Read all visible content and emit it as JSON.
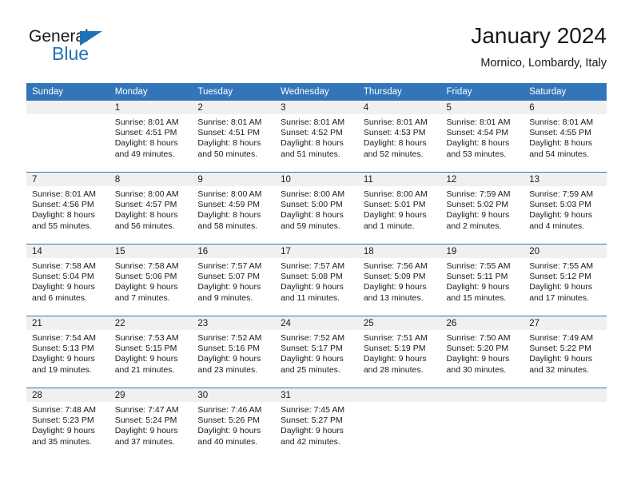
{
  "brand": {
    "name_top": "General",
    "name_bottom": "Blue",
    "accent_color": "#1e72b8"
  },
  "header": {
    "title": "January 2024",
    "subtitle": "Mornico, Lombardy, Italy"
  },
  "calendar": {
    "header_bg": "#3275b9",
    "daynum_bg": "#f0f0f0",
    "weekday_headers": [
      "Sunday",
      "Monday",
      "Tuesday",
      "Wednesday",
      "Thursday",
      "Friday",
      "Saturday"
    ],
    "weeks": [
      [
        {
          "day": ""
        },
        {
          "day": "1",
          "sunrise": "Sunrise: 8:01 AM",
          "sunset": "Sunset: 4:51 PM",
          "daylight_1": "Daylight: 8 hours",
          "daylight_2": "and 49 minutes."
        },
        {
          "day": "2",
          "sunrise": "Sunrise: 8:01 AM",
          "sunset": "Sunset: 4:51 PM",
          "daylight_1": "Daylight: 8 hours",
          "daylight_2": "and 50 minutes."
        },
        {
          "day": "3",
          "sunrise": "Sunrise: 8:01 AM",
          "sunset": "Sunset: 4:52 PM",
          "daylight_1": "Daylight: 8 hours",
          "daylight_2": "and 51 minutes."
        },
        {
          "day": "4",
          "sunrise": "Sunrise: 8:01 AM",
          "sunset": "Sunset: 4:53 PM",
          "daylight_1": "Daylight: 8 hours",
          "daylight_2": "and 52 minutes."
        },
        {
          "day": "5",
          "sunrise": "Sunrise: 8:01 AM",
          "sunset": "Sunset: 4:54 PM",
          "daylight_1": "Daylight: 8 hours",
          "daylight_2": "and 53 minutes."
        },
        {
          "day": "6",
          "sunrise": "Sunrise: 8:01 AM",
          "sunset": "Sunset: 4:55 PM",
          "daylight_1": "Daylight: 8 hours",
          "daylight_2": "and 54 minutes."
        }
      ],
      [
        {
          "day": "7",
          "sunrise": "Sunrise: 8:01 AM",
          "sunset": "Sunset: 4:56 PM",
          "daylight_1": "Daylight: 8 hours",
          "daylight_2": "and 55 minutes."
        },
        {
          "day": "8",
          "sunrise": "Sunrise: 8:00 AM",
          "sunset": "Sunset: 4:57 PM",
          "daylight_1": "Daylight: 8 hours",
          "daylight_2": "and 56 minutes."
        },
        {
          "day": "9",
          "sunrise": "Sunrise: 8:00 AM",
          "sunset": "Sunset: 4:59 PM",
          "daylight_1": "Daylight: 8 hours",
          "daylight_2": "and 58 minutes."
        },
        {
          "day": "10",
          "sunrise": "Sunrise: 8:00 AM",
          "sunset": "Sunset: 5:00 PM",
          "daylight_1": "Daylight: 8 hours",
          "daylight_2": "and 59 minutes."
        },
        {
          "day": "11",
          "sunrise": "Sunrise: 8:00 AM",
          "sunset": "Sunset: 5:01 PM",
          "daylight_1": "Daylight: 9 hours",
          "daylight_2": "and 1 minute."
        },
        {
          "day": "12",
          "sunrise": "Sunrise: 7:59 AM",
          "sunset": "Sunset: 5:02 PM",
          "daylight_1": "Daylight: 9 hours",
          "daylight_2": "and 2 minutes."
        },
        {
          "day": "13",
          "sunrise": "Sunrise: 7:59 AM",
          "sunset": "Sunset: 5:03 PM",
          "daylight_1": "Daylight: 9 hours",
          "daylight_2": "and 4 minutes."
        }
      ],
      [
        {
          "day": "14",
          "sunrise": "Sunrise: 7:58 AM",
          "sunset": "Sunset: 5:04 PM",
          "daylight_1": "Daylight: 9 hours",
          "daylight_2": "and 6 minutes."
        },
        {
          "day": "15",
          "sunrise": "Sunrise: 7:58 AM",
          "sunset": "Sunset: 5:06 PM",
          "daylight_1": "Daylight: 9 hours",
          "daylight_2": "and 7 minutes."
        },
        {
          "day": "16",
          "sunrise": "Sunrise: 7:57 AM",
          "sunset": "Sunset: 5:07 PM",
          "daylight_1": "Daylight: 9 hours",
          "daylight_2": "and 9 minutes."
        },
        {
          "day": "17",
          "sunrise": "Sunrise: 7:57 AM",
          "sunset": "Sunset: 5:08 PM",
          "daylight_1": "Daylight: 9 hours",
          "daylight_2": "and 11 minutes."
        },
        {
          "day": "18",
          "sunrise": "Sunrise: 7:56 AM",
          "sunset": "Sunset: 5:09 PM",
          "daylight_1": "Daylight: 9 hours",
          "daylight_2": "and 13 minutes."
        },
        {
          "day": "19",
          "sunrise": "Sunrise: 7:55 AM",
          "sunset": "Sunset: 5:11 PM",
          "daylight_1": "Daylight: 9 hours",
          "daylight_2": "and 15 minutes."
        },
        {
          "day": "20",
          "sunrise": "Sunrise: 7:55 AM",
          "sunset": "Sunset: 5:12 PM",
          "daylight_1": "Daylight: 9 hours",
          "daylight_2": "and 17 minutes."
        }
      ],
      [
        {
          "day": "21",
          "sunrise": "Sunrise: 7:54 AM",
          "sunset": "Sunset: 5:13 PM",
          "daylight_1": "Daylight: 9 hours",
          "daylight_2": "and 19 minutes."
        },
        {
          "day": "22",
          "sunrise": "Sunrise: 7:53 AM",
          "sunset": "Sunset: 5:15 PM",
          "daylight_1": "Daylight: 9 hours",
          "daylight_2": "and 21 minutes."
        },
        {
          "day": "23",
          "sunrise": "Sunrise: 7:52 AM",
          "sunset": "Sunset: 5:16 PM",
          "daylight_1": "Daylight: 9 hours",
          "daylight_2": "and 23 minutes."
        },
        {
          "day": "24",
          "sunrise": "Sunrise: 7:52 AM",
          "sunset": "Sunset: 5:17 PM",
          "daylight_1": "Daylight: 9 hours",
          "daylight_2": "and 25 minutes."
        },
        {
          "day": "25",
          "sunrise": "Sunrise: 7:51 AM",
          "sunset": "Sunset: 5:19 PM",
          "daylight_1": "Daylight: 9 hours",
          "daylight_2": "and 28 minutes."
        },
        {
          "day": "26",
          "sunrise": "Sunrise: 7:50 AM",
          "sunset": "Sunset: 5:20 PM",
          "daylight_1": "Daylight: 9 hours",
          "daylight_2": "and 30 minutes."
        },
        {
          "day": "27",
          "sunrise": "Sunrise: 7:49 AM",
          "sunset": "Sunset: 5:22 PM",
          "daylight_1": "Daylight: 9 hours",
          "daylight_2": "and 32 minutes."
        }
      ],
      [
        {
          "day": "28",
          "sunrise": "Sunrise: 7:48 AM",
          "sunset": "Sunset: 5:23 PM",
          "daylight_1": "Daylight: 9 hours",
          "daylight_2": "and 35 minutes."
        },
        {
          "day": "29",
          "sunrise": "Sunrise: 7:47 AM",
          "sunset": "Sunset: 5:24 PM",
          "daylight_1": "Daylight: 9 hours",
          "daylight_2": "and 37 minutes."
        },
        {
          "day": "30",
          "sunrise": "Sunrise: 7:46 AM",
          "sunset": "Sunset: 5:26 PM",
          "daylight_1": "Daylight: 9 hours",
          "daylight_2": "and 40 minutes."
        },
        {
          "day": "31",
          "sunrise": "Sunrise: 7:45 AM",
          "sunset": "Sunset: 5:27 PM",
          "daylight_1": "Daylight: 9 hours",
          "daylight_2": "and 42 minutes."
        },
        {
          "day": ""
        },
        {
          "day": ""
        },
        {
          "day": ""
        }
      ]
    ]
  }
}
